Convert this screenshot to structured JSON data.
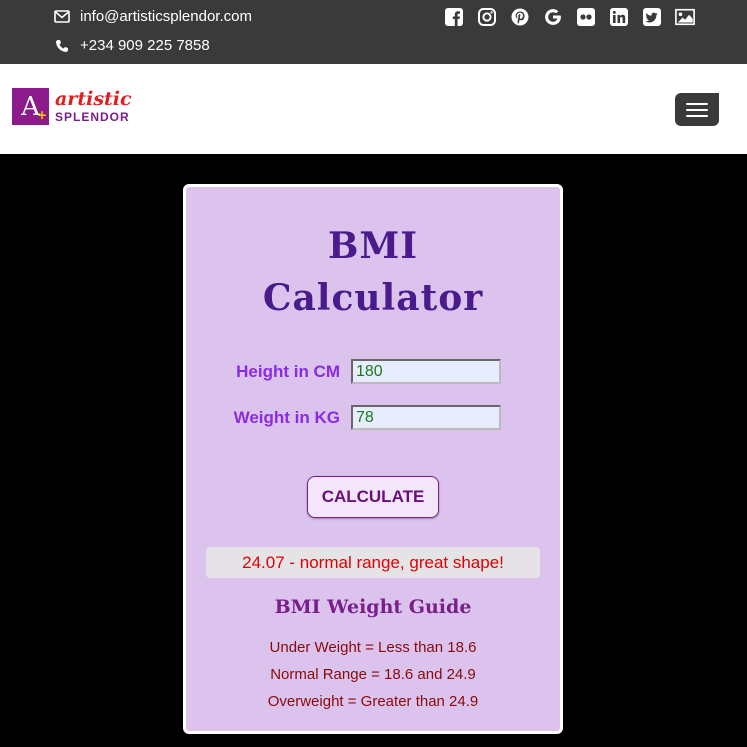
{
  "topbar": {
    "email": "info@artisticsplendor.com",
    "phone": "+234 909 225 7858",
    "contact_icons": [
      "envelope-icon",
      "phone-icon"
    ],
    "social_icons": [
      "facebook-icon",
      "instagram-icon",
      "pinterest-icon",
      "google-icon",
      "flickr-icon",
      "linkedin-icon",
      "twitter-icon",
      "image-gallery-icon"
    ]
  },
  "header": {
    "logo_mark": "A",
    "logo_line1": "artistic",
    "logo_line2": "SPLENDOR"
  },
  "calculator": {
    "title_line1": "BMI",
    "title_line2": "Calculator",
    "height_label": "Height in CM",
    "height_value": "180",
    "weight_label": "Weight in KG",
    "weight_value": "78",
    "button_label": "CALCULATE",
    "result_text": "24.07 - normal range, great shape!"
  },
  "guide": {
    "title": "BMI Weight Guide",
    "lines": [
      "Under Weight = Less than 18.6",
      "Normal Range = 18.6 and 24.9",
      "Overweight = Greater than 24.9"
    ]
  },
  "colors": {
    "topbar_bg": "#3a3a3a",
    "card_bg": "#dbc3ee",
    "title_purple": "#4a1b8a",
    "label_purple": "#8a2be2",
    "result_red": "#e00000",
    "guide_text": "#8a0a0a"
  }
}
